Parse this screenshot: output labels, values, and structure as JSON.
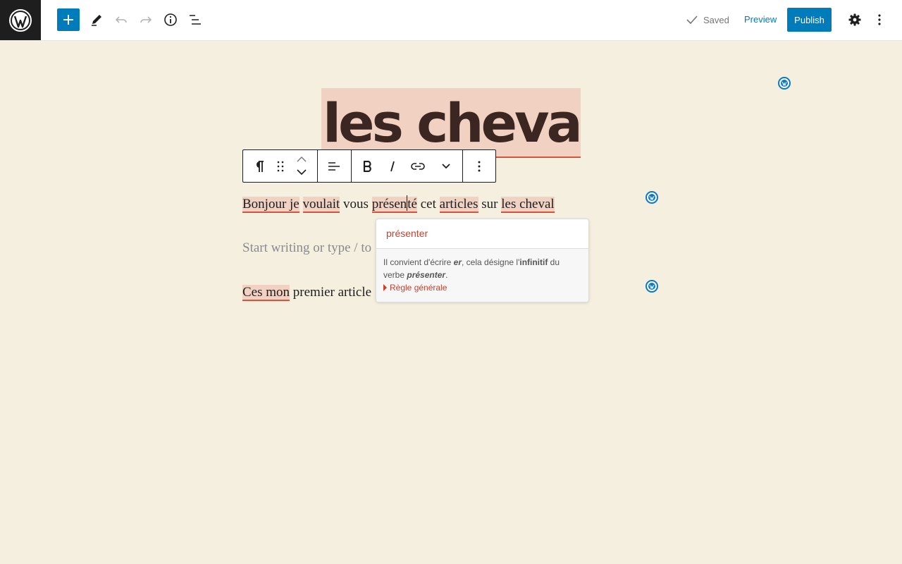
{
  "toolbar": {
    "saved_label": "Saved",
    "preview_label": "Preview",
    "publish_label": "Publish"
  },
  "post": {
    "title": "les cheval",
    "paragraph1": {
      "bonjour_je": "Bonjour je",
      "voulait": "voulait",
      "vous": "vous",
      "presen": "présen",
      "te": "té",
      "cet": "cet",
      "articles": "articles",
      "sur": "sur",
      "les_cheval": "les cheval"
    },
    "placeholder_visible": "Start writing or type / to",
    "paragraph3": {
      "ces_mon": "Ces mon",
      "rest": "premier article"
    }
  },
  "suggestion": {
    "replacement": "présenter",
    "explanation_1": "Il convient d'écrire ",
    "explanation_er": "er",
    "explanation_2": ", cela désigne l'",
    "explanation_inf": "infinitif",
    "explanation_3": " du verbe ",
    "explanation_verb": "présenter",
    "explanation_4": ".",
    "rule_label": "Règle générale"
  },
  "colors": {
    "accent": "#007cba",
    "highlight": "#f0d1c2",
    "error_underline": "#d6533e",
    "background": "#f5efe0"
  }
}
